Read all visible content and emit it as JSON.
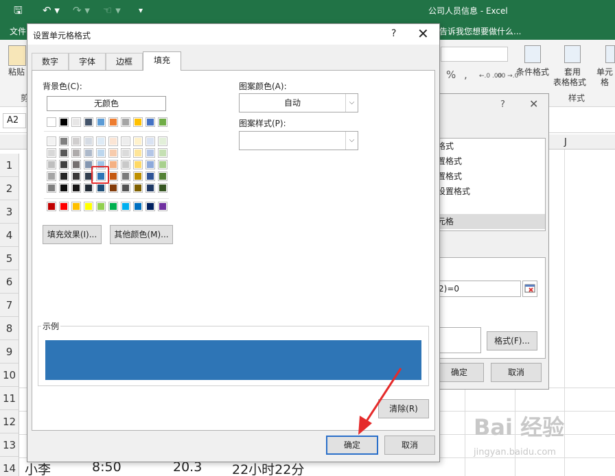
{
  "app": {
    "window_title": "公司人员信息 - Excel",
    "file_tab": "文件",
    "tell_me": "告诉我您想要做什么..."
  },
  "ribbon": {
    "paste_label": "粘贴",
    "clipboard_group": "剪",
    "percent": "%",
    "comma": ",",
    "dec_inc": "←.0 .00",
    "dec_dec": ".00 →.0",
    "cond_format": "条件格式",
    "table_format_1": "套用",
    "table_format_2": "表格格式",
    "cell_styles": "单元格",
    "styles_group": "样式"
  },
  "formula_bar": {
    "name_box": "A2"
  },
  "grid": {
    "col_j": "J",
    "rows": [
      "1",
      "2",
      "3",
      "4",
      "5",
      "6",
      "7",
      "8",
      "9",
      "10",
      "11",
      "12",
      "13",
      "14"
    ],
    "row14_name": "小李",
    "row14_time": "8:50",
    "row14_num": "20.3",
    "row14_dur": "22小时22分"
  },
  "bg_dialog": {
    "help": "?",
    "close": "✕",
    "list_items": [
      "格式",
      "置格式",
      "置格式",
      "设置格式",
      "",
      "元格"
    ],
    "formula": "2)=0",
    "format_button": "格式(F)...",
    "ok_button": "确定",
    "cancel_button": "取消"
  },
  "dialog": {
    "title": "设置单元格格式",
    "help": "?",
    "close": "✕",
    "tabs": [
      "数字",
      "字体",
      "边框",
      "填充"
    ],
    "active_tab": 3,
    "background_color_label": "背景色(C):",
    "no_color_button": "无颜色",
    "pattern_color_label": "图案颜色(A):",
    "pattern_color_value": "自动",
    "pattern_style_label": "图案样式(P):",
    "pattern_style_value": "",
    "fill_effects_button": "填充效果(I)...",
    "more_colors_button": "其他颜色(M)...",
    "sample_label": "示例",
    "sample_color": "#2e75b6",
    "clear_button": "清除(R)",
    "ok_button": "确定",
    "cancel_button": "取消",
    "selected_swatch": "row 4, column 5",
    "palette_theme_top": [
      "#ffffff",
      "#000000",
      "#e7e6e6",
      "#44546a",
      "#5b9bd5",
      "#ed7d31",
      "#a5a5a5",
      "#ffc000",
      "#4472c4",
      "#70ad47"
    ],
    "palette_theme_tints": [
      [
        "#f2f2f2",
        "#7f7f7f",
        "#d0cece",
        "#d6dce4",
        "#deebf6",
        "#fbe5d5",
        "#ededed",
        "#fff2cc",
        "#dae3f3",
        "#e2efd9"
      ],
      [
        "#d8d8d8",
        "#595959",
        "#aeabab",
        "#adb9ca",
        "#bdd7ee",
        "#f7cbac",
        "#dbdbdb",
        "#fee599",
        "#b4c6e7",
        "#c5e0b3"
      ],
      [
        "#bfbfbf",
        "#3f3f3f",
        "#757070",
        "#8496b0",
        "#9dc3e6",
        "#f4b183",
        "#c9c9c9",
        "#ffd965",
        "#8eaadb",
        "#a8d08d"
      ],
      [
        "#a5a5a5",
        "#262626",
        "#3a3838",
        "#323f4f",
        "#2e75b6",
        "#c55a11",
        "#7b7b7b",
        "#bf9000",
        "#2f5496",
        "#538135"
      ],
      [
        "#7f7f7f",
        "#0c0c0c",
        "#171616",
        "#222a35",
        "#1e4e79",
        "#833c0b",
        "#525252",
        "#7f6000",
        "#1f3864",
        "#375623"
      ]
    ],
    "palette_standard": [
      "#c00000",
      "#ff0000",
      "#ffc000",
      "#ffff00",
      "#92d050",
      "#00b050",
      "#00b0f0",
      "#0070c0",
      "#002060",
      "#7030a0"
    ]
  },
  "watermark": {
    "text": "Bai 经验",
    "url": "jingyan.baidu.com"
  }
}
